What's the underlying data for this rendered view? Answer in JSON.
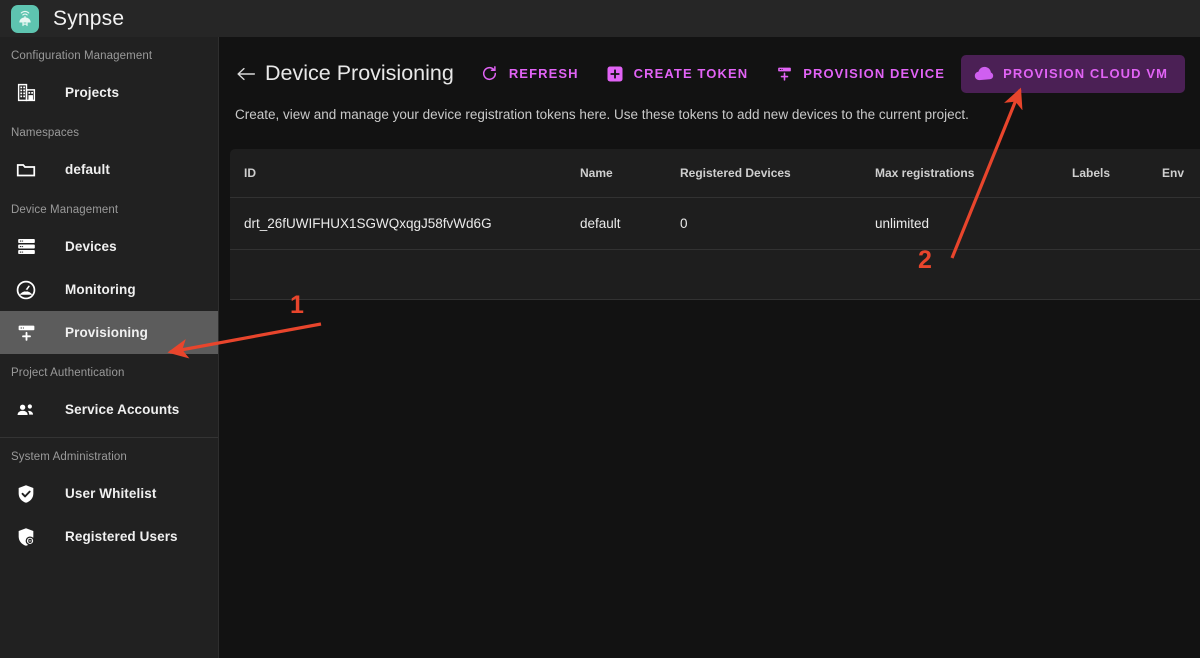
{
  "app": {
    "brand": "Synpse",
    "logo_icon": "synpse-cloud-logo-icon",
    "logo_color": "#5ec4b0"
  },
  "sidebar": {
    "groups": [
      {
        "label": "Configuration Management",
        "items": [
          {
            "label": "Projects",
            "icon": "building-icon",
            "active": false
          }
        ]
      },
      {
        "label": "Namespaces",
        "items": [
          {
            "label": "default",
            "icon": "folder-icon",
            "active": false
          }
        ]
      },
      {
        "label": "Device Management",
        "items": [
          {
            "label": "Devices",
            "icon": "server-rack-icon",
            "active": false
          },
          {
            "label": "Monitoring",
            "icon": "gauge-icon",
            "active": false
          },
          {
            "label": "Provisioning",
            "icon": "server-plus-icon",
            "active": true
          }
        ]
      },
      {
        "label": "Project Authentication",
        "items": [
          {
            "label": "Service Accounts",
            "icon": "people-icon",
            "active": false
          }
        ]
      },
      {
        "label": "System Administration",
        "items": [
          {
            "label": "User Whitelist",
            "icon": "shield-check-icon",
            "active": false
          },
          {
            "label": "Registered Users",
            "icon": "shield-user-icon",
            "active": false
          }
        ]
      }
    ]
  },
  "page": {
    "back_icon": "arrow-left-icon",
    "title": "Device Provisioning",
    "description": "Create, view and manage your device registration tokens here. Use these tokens to add new devices to the current project.",
    "actions": [
      {
        "label": "REFRESH",
        "icon": "refresh-icon",
        "style": "text"
      },
      {
        "label": "CREATE TOKEN",
        "icon": "plus-square-icon",
        "style": "text"
      },
      {
        "label": "PROVISION DEVICE",
        "icon": "server-plus-icon",
        "style": "text"
      },
      {
        "label": "PROVISION CLOUD VM",
        "icon": "cloud-icon",
        "style": "filled"
      }
    ],
    "accent_color": "#e163f5",
    "filled_button_bg": "#4b2055"
  },
  "table": {
    "columns": [
      "ID",
      "Name",
      "Registered Devices",
      "Max registrations",
      "Labels",
      "Env"
    ],
    "rows": [
      {
        "id": "drt_26fUWIFHUX1SGWQxqgJ58fvWd6G",
        "name": "default",
        "registered_devices": "0",
        "max_registrations": "unlimited",
        "labels": "",
        "env": ""
      }
    ]
  },
  "annotations": {
    "color": "#e8452c",
    "markers": [
      {
        "number": "1",
        "points_to": "sidebar-item-provisioning"
      },
      {
        "number": "2",
        "points_to": "provision-cloud-vm-button"
      }
    ]
  }
}
